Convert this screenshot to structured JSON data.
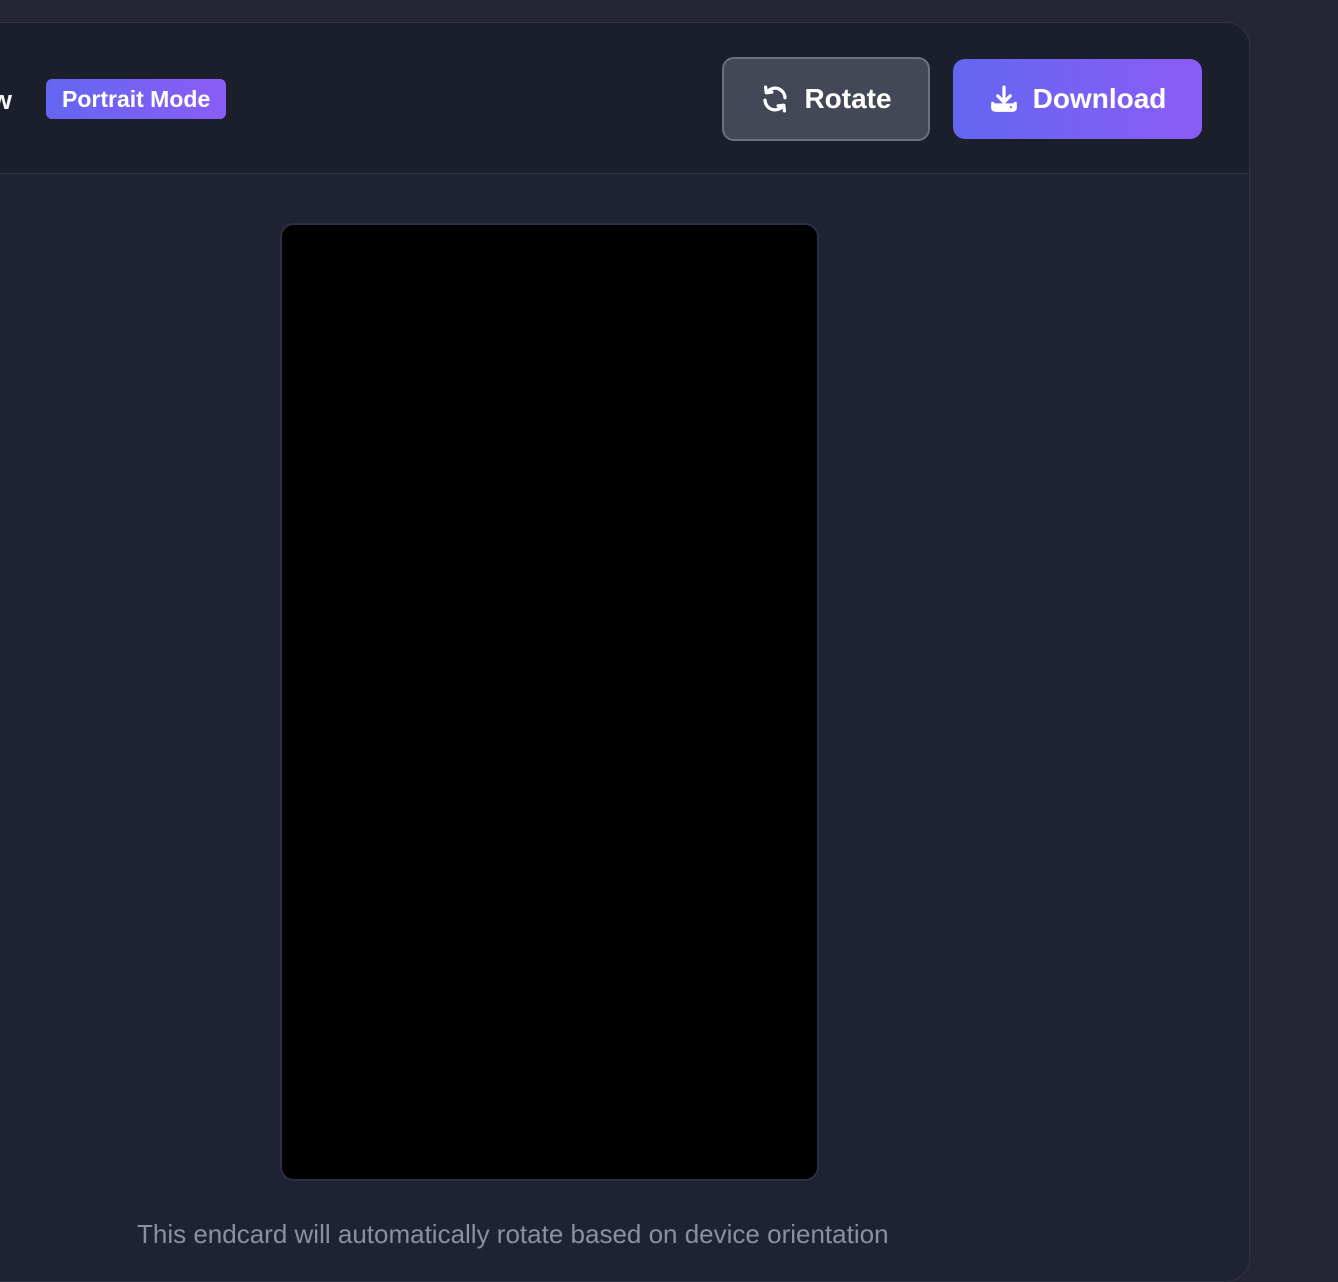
{
  "header": {
    "title_fragment": "w",
    "mode_badge": "Portrait Mode",
    "rotate_button": {
      "label": "Rotate",
      "icon": "rotate-icon"
    },
    "download_button": {
      "label": "Download",
      "icon": "download-icon"
    }
  },
  "preview": {
    "content": ""
  },
  "footer": {
    "note": "This endcard will automatically rotate based on device orientation"
  },
  "colors": {
    "page_background": "#242635",
    "panel_background": "#1e2233",
    "header_background": "#1b1f2c",
    "accent_start": "#6366f1",
    "accent_end": "#8b5cf6",
    "rotate_button_background": "#434857",
    "preview_background": "#000000"
  }
}
